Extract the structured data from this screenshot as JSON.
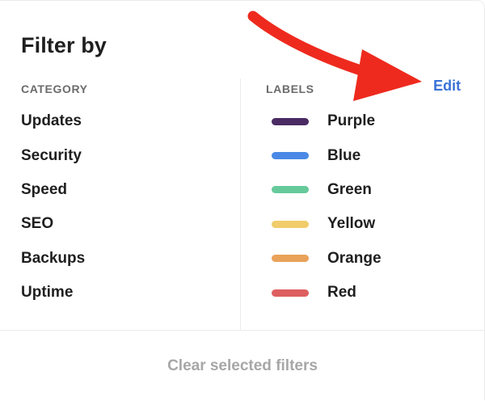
{
  "panel": {
    "title": "Filter by",
    "clear_label": "Clear selected filters"
  },
  "category": {
    "header": "CATEGORY",
    "items": [
      "Updates",
      "Security",
      "Speed",
      "SEO",
      "Backups",
      "Uptime"
    ]
  },
  "labels": {
    "header": "LABELS",
    "edit_label": "Edit",
    "items": [
      {
        "name": "Purple",
        "color": "#4a2b63"
      },
      {
        "name": "Blue",
        "color": "#4a8ae6"
      },
      {
        "name": "Green",
        "color": "#66c99a"
      },
      {
        "name": "Yellow",
        "color": "#f0cc6a"
      },
      {
        "name": "Orange",
        "color": "#e9a25a"
      },
      {
        "name": "Red",
        "color": "#de5f5f"
      }
    ]
  },
  "annotation": {
    "arrow_color": "#ee2a1e",
    "icon": "red-arrow-icon"
  },
  "colors": {
    "accent": "#3a73d6",
    "text": "#1f1f1f",
    "muted": "#6b6b6b",
    "disabled": "#a7a7a7"
  }
}
